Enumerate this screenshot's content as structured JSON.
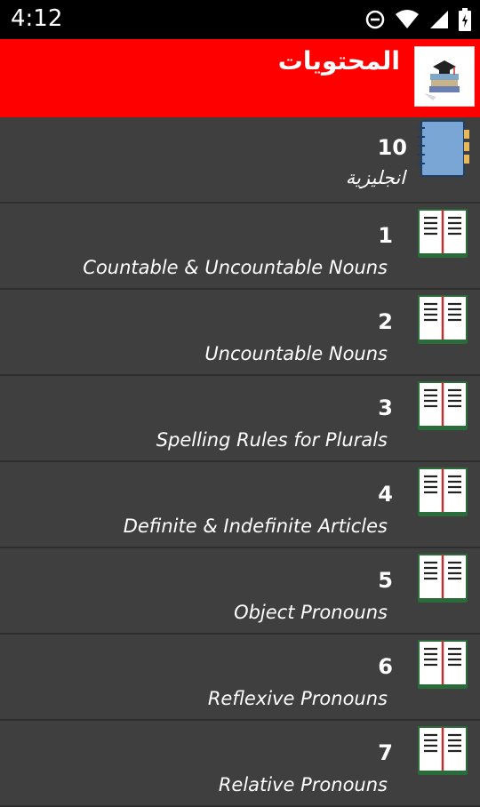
{
  "status_bar": {
    "time": "4:12",
    "icons": [
      "do-not-disturb-icon",
      "wifi-icon",
      "signal-icon",
      "battery-icon"
    ]
  },
  "app_bar": {
    "title": "المحتويات",
    "background_color": "#ff0000"
  },
  "list": {
    "header": {
      "number": "10",
      "subtitle": "انجليزية",
      "icon": "notebook-icon"
    },
    "items": [
      {
        "number": "1",
        "title": "Countable & Uncountable Nouns"
      },
      {
        "number": "2",
        "title": "Uncountable Nouns"
      },
      {
        "number": "3",
        "title": "Spelling Rules for Plurals"
      },
      {
        "number": "4",
        "title": "Definite & Indefinite Articles"
      },
      {
        "number": "5",
        "title": "Object Pronouns"
      },
      {
        "number": "6",
        "title": "Reflexive Pronouns"
      },
      {
        "number": "7",
        "title": "Relative Pronouns"
      }
    ]
  }
}
